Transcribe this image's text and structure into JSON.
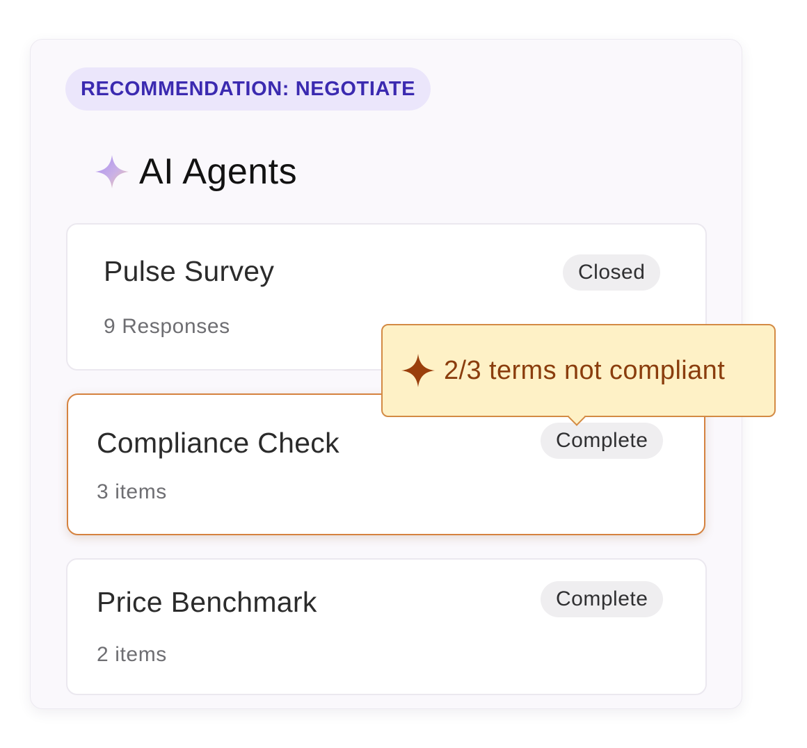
{
  "recommendation": {
    "label": "RECOMMENDATION: NEGOTIATE"
  },
  "section": {
    "title": "AI Agents",
    "icon": "sparkle-icon"
  },
  "agents": [
    {
      "title": "Pulse Survey",
      "subtitle": "9 Responses",
      "status": "Closed"
    },
    {
      "title": "Compliance Check",
      "subtitle": "3 items",
      "status": "Complete"
    },
    {
      "title": "Price Benchmark",
      "subtitle": "2 items",
      "status": "Complete"
    }
  ],
  "tooltip": {
    "text": "2/3 terms not compliant",
    "icon": "sparkle-icon"
  },
  "colors": {
    "accent_purple": "#3b2ab0",
    "badge_bg": "#ebe6fb",
    "highlight_border": "#d5823f",
    "tooltip_bg": "#fef1c6",
    "tooltip_text": "#8a3d0d"
  }
}
